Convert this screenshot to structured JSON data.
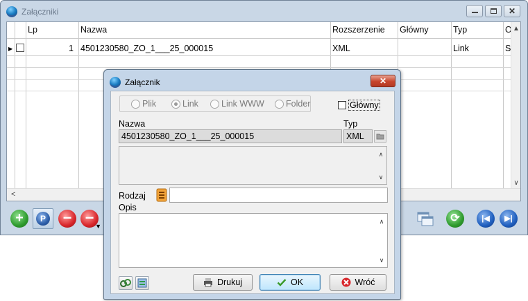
{
  "bg_window": {
    "title": "Załączniki",
    "columns": [
      "Lp",
      "Nazwa",
      "Rozszerzenie",
      "Główny",
      "Typ",
      "O"
    ],
    "rows": [
      {
        "lp": "1",
        "nazwa": "4501230580_ZO_1___25_000015",
        "rozszerzenie": "XML",
        "glowny": "",
        "typ": "Link",
        "o": "S"
      }
    ]
  },
  "dialog": {
    "title": "Załącznik",
    "close_label": "✕",
    "radio_options": [
      "Plik",
      "Link",
      "Link WWW",
      "Folder"
    ],
    "radio_selected": "Link",
    "glowny_label": "Główny",
    "glowny_checked": false,
    "nazwa_label": "Nazwa",
    "nazwa_value": "4501230580_ZO_1___25_000015",
    "typ_label": "Typ",
    "typ_value": "XML",
    "rodzaj_label": "Rodzaj",
    "rodzaj_value": "",
    "opis_label": "Opis",
    "opis_value": "",
    "buttons": {
      "print": "Drukuj",
      "ok": "OK",
      "back": "Wróć"
    }
  },
  "colors": {
    "title_bar": "#c9d7e6",
    "dialog_frame": "#c4d5e8",
    "close_red": "#c7452c",
    "add_green": "#2e9b2e",
    "remove_red": "#d8262b",
    "nav_blue": "#1f5fbf"
  }
}
